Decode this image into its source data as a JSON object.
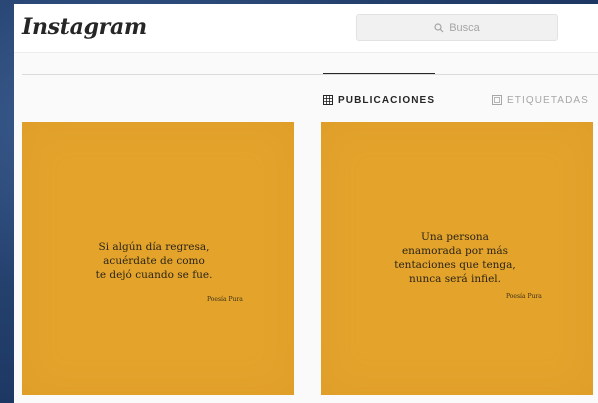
{
  "header": {
    "logo": "Instagram",
    "search_placeholder": "Busca"
  },
  "tabs": [
    {
      "label": "PUBLICACIONES",
      "icon": "grid-icon",
      "active": true
    },
    {
      "label": "ETIQUETADAS",
      "icon": "tag-icon",
      "active": false
    }
  ],
  "posts": [
    {
      "lines": [
        "Si algún día regresa,",
        "acuérdate de como",
        "te dejó cuando se fue."
      ],
      "signature": "Poesía Pura",
      "background": "#e4a42c"
    },
    {
      "lines": [
        "Una persona",
        "enamorada por más",
        "tentaciones que tenga,",
        "nunca será infiel."
      ],
      "signature": "Poesía Pura",
      "background": "#e4a42c"
    }
  ]
}
